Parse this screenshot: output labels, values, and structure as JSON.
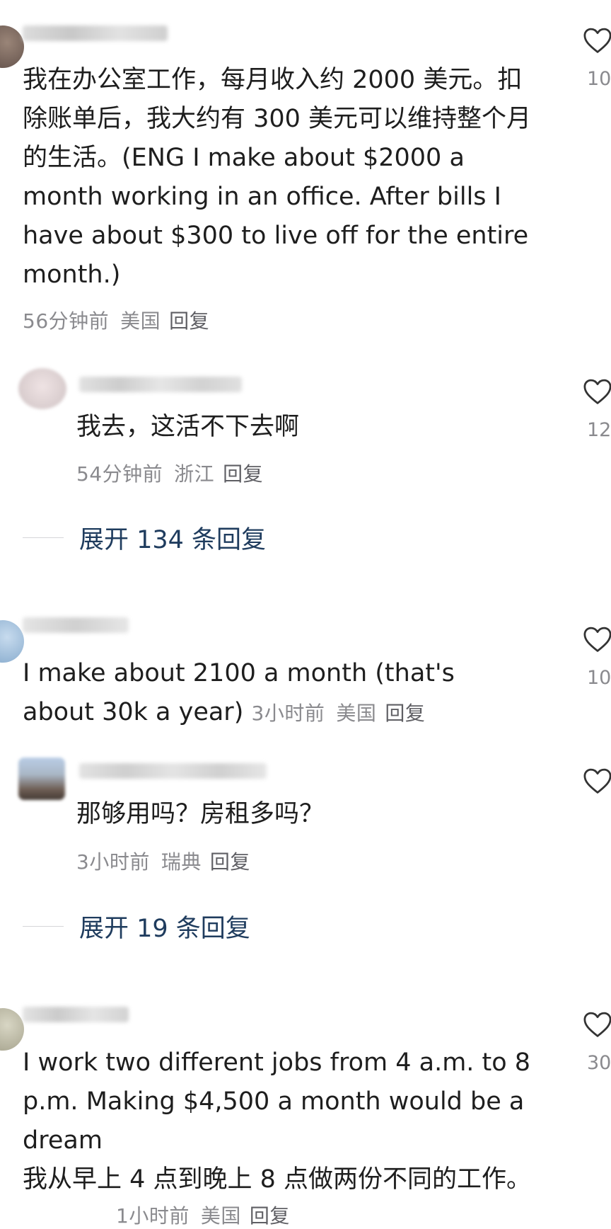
{
  "comments": [
    {
      "body": "我在办公室工作，每月收入约 2000 美元。扣除账单后，我大约有 300 美元可以维持整个月的生活。(ENG I make about $2000 a month working in an office. After bills I have about $300 to live off for the entire month.)",
      "time": "56分钟前",
      "region": "美国",
      "reply_label": "回复",
      "like_count": "10",
      "reply": {
        "body": "我去，这活不下去啊",
        "time": "54分钟前",
        "region": "浙江",
        "reply_label": "回复",
        "like_count": "12"
      },
      "expand_label": "展开 134 条回复"
    },
    {
      "body": "I make about 2100 a month (that's about 30k a year)",
      "time": "3小时前",
      "region": "美国",
      "reply_label": "回复",
      "like_count": "10",
      "reply": {
        "body": "那够用吗？房租多吗？",
        "time": "3小时前",
        "region": "瑞典",
        "reply_label": "回复",
        "like_count": ""
      },
      "expand_label": "展开 19 条回复"
    },
    {
      "body": "I work two different jobs from 4 a.m. to 8 p.m. Making $4,500 a month would be a dream\n我从早上 4 点到晚上 8 点做两份不同的工作。",
      "time": "1小时前",
      "region": "美国",
      "reply_label": "回复",
      "like_count": "30"
    }
  ],
  "icons": {
    "like": "heart-outline-icon"
  },
  "colors": {
    "text": "#1e1e1e",
    "meta": "#8a8a8e",
    "expand": "#1f3c5e",
    "divider": "#d5d5d8"
  }
}
